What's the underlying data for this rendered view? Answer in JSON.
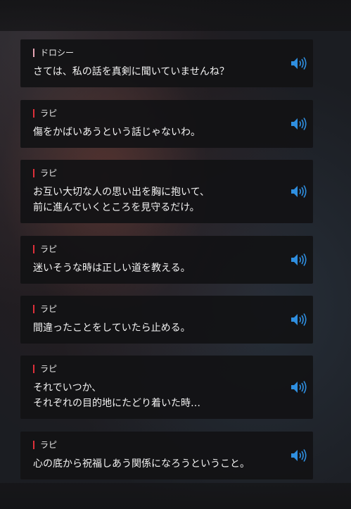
{
  "backlog": {
    "entries": [
      {
        "speaker": "ドロシー",
        "text": "さては、私の話を真剣に聞いていませんね？"
      },
      {
        "speaker": "ラピ",
        "text": "傷をかばいあうという話じゃないわ。"
      },
      {
        "speaker": "ラピ",
        "text": "お互い大切な人の思い出を胸に抱いて、\n前に進んでいくところを見守るだけ。"
      },
      {
        "speaker": "ラピ",
        "text": "迷いそうな時は正しい道を教える。"
      },
      {
        "speaker": "ラピ",
        "text": "間違ったことをしていたら止める。"
      },
      {
        "speaker": "ラピ",
        "text": "それでいつか、\nそれぞれの目的地にたどり着いた時…"
      },
      {
        "speaker": "ラピ",
        "text": "心の底から祝福しあう関係になろうということ。"
      }
    ]
  },
  "colors": {
    "voice_icon": "#2f8fe0",
    "speaker_bar_rapi": "#e0303a",
    "speaker_bar_dorothy": "#e8a6b6"
  },
  "icons": {
    "voice": "speaker-icon"
  }
}
